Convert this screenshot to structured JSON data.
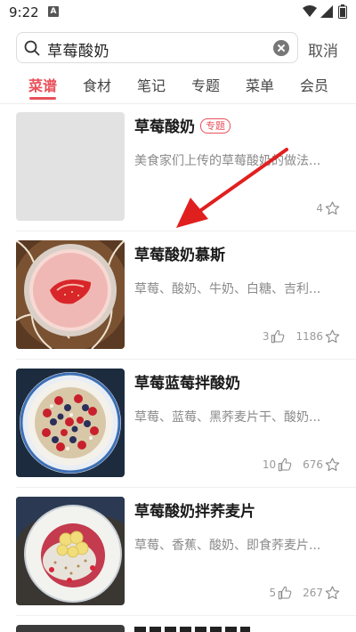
{
  "status_bar": {
    "time": "9:22",
    "notification_icon": "A"
  },
  "search": {
    "query": "草莓酸奶",
    "cancel_label": "取消"
  },
  "tabs": [
    {
      "label": "菜谱",
      "active": true
    },
    {
      "label": "食材",
      "active": false
    },
    {
      "label": "笔记",
      "active": false
    },
    {
      "label": "专题",
      "active": false
    },
    {
      "label": "菜单",
      "active": false
    },
    {
      "label": "会员",
      "active": false
    }
  ],
  "results": [
    {
      "title": "草莓酸奶",
      "badge": "专题",
      "desc": "美食家们上传的草莓酸奶的做法...",
      "likes": "",
      "favorites": "4",
      "thumb": "placeholder"
    },
    {
      "title": "草莓酸奶慕斯",
      "badge": "",
      "desc": "草莓、酸奶、牛奶、白糖、吉利...",
      "likes": "3",
      "favorites": "1186",
      "thumb": "mousse"
    },
    {
      "title": "草莓蓝莓拌酸奶",
      "badge": "",
      "desc": "草莓、蓝莓、黑荞麦片干、酸奶...",
      "likes": "10",
      "favorites": "676",
      "thumb": "berry-bowl"
    },
    {
      "title": "草莓酸奶拌荞麦片",
      "badge": "",
      "desc": "草莓、香蕉、酸奶、即食荞麦片...",
      "likes": "5",
      "favorites": "267",
      "thumb": "banana-plate"
    }
  ],
  "colors": {
    "accent": "#e8505b",
    "annotation_arrow": "#e0201f"
  }
}
